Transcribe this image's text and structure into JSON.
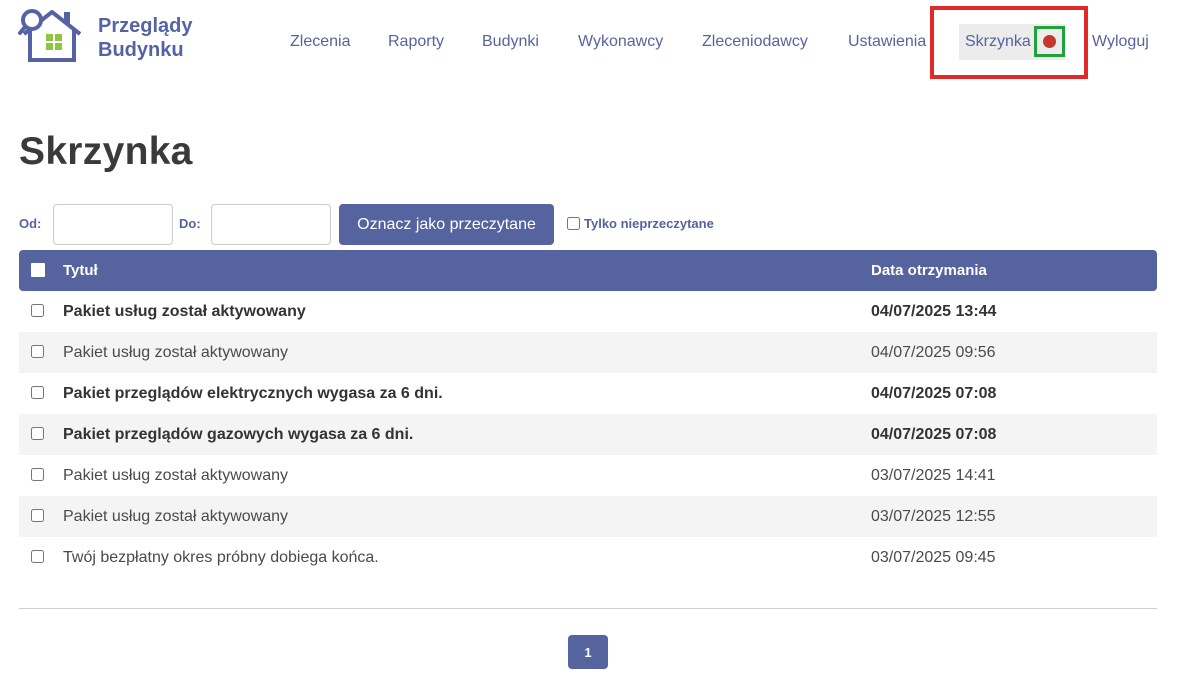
{
  "brand": {
    "line1": "Przeglądy",
    "line2": "Budynku",
    "color": "#5563a5",
    "accent": "#8dc63f"
  },
  "nav": {
    "items": [
      {
        "label": "Zlecenia"
      },
      {
        "label": "Raporty"
      },
      {
        "label": "Budynki"
      },
      {
        "label": "Wykonawcy"
      },
      {
        "label": "Zleceniodawcy"
      },
      {
        "label": "Ustawienia"
      },
      {
        "label": "Skrzynka",
        "active": true,
        "unread_indicator": "red-dot-icon"
      },
      {
        "label": "Wyloguj"
      }
    ]
  },
  "page": {
    "title": "Skrzynka"
  },
  "filters": {
    "from_label": "Od:",
    "from_value": "",
    "to_label": "Do:",
    "to_value": "",
    "mark_read_label": "Oznacz jako przeczytane",
    "unread_only_label": "Tylko nieprzeczytane",
    "unread_only_checked": false
  },
  "table": {
    "columns": [
      "Tytuł",
      "Data otrzymania"
    ],
    "rows": [
      {
        "title": "Pakiet usług został aktywowany",
        "date": "04/07/2025 13:44",
        "unread": true
      },
      {
        "title": "Pakiet usług został aktywowany",
        "date": "04/07/2025 09:56",
        "unread": false
      },
      {
        "title": "Pakiet przeglądów elektrycznych wygasa za 6 dni.",
        "date": "04/07/2025 07:08",
        "unread": true
      },
      {
        "title": "Pakiet przeglądów gazowych wygasa za 6 dni.",
        "date": "04/07/2025 07:08",
        "unread": true
      },
      {
        "title": "Pakiet usług został aktywowany",
        "date": "03/07/2025 14:41",
        "unread": false
      },
      {
        "title": "Pakiet usług został aktywowany",
        "date": "03/07/2025 12:55",
        "unread": false
      },
      {
        "title": "Twój bezpłatny okres próbny dobiega końca.",
        "date": "03/07/2025 09:45",
        "unread": false
      }
    ]
  },
  "pagination": {
    "current": "1"
  },
  "colors": {
    "primary": "#55639f",
    "nav_text": "#58639e",
    "notification": "#c0392b",
    "highlight_red": "#e02a2a",
    "highlight_green": "#1ea23a"
  }
}
